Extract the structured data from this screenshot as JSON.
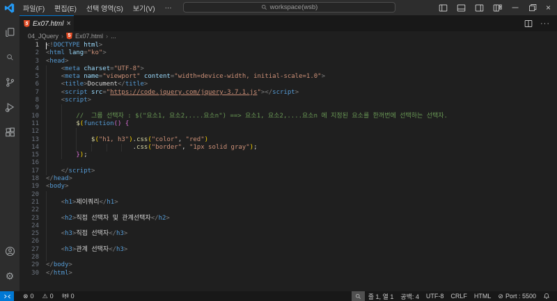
{
  "colors": {
    "accent": "#0078d4",
    "html_icon": "#e44d26",
    "remote_bg": "#0078d4"
  },
  "title_bar": {
    "menus": [
      {
        "name": "menu-file",
        "label": "파일(F)"
      },
      {
        "name": "menu-edit",
        "label": "편집(E)"
      },
      {
        "name": "menu-selection",
        "label": "선택 영역(S)"
      },
      {
        "name": "menu-view",
        "label": "보기(V)"
      },
      {
        "name": "menu-more",
        "label": "···"
      }
    ],
    "back_arrow": "←",
    "forward_arrow": "→",
    "command_center": "workspace(wsb)",
    "layout_icons": [
      "panel-left",
      "panel-bottom",
      "panel-right",
      "layout-customize"
    ],
    "window_controls": [
      "minimize",
      "restore",
      "close"
    ]
  },
  "activity_bar": {
    "top": [
      "explorer",
      "search",
      "source-control",
      "run-debug",
      "extensions"
    ],
    "bottom": [
      "accounts",
      "settings"
    ]
  },
  "editor": {
    "tab": {
      "label": "Ex07.html",
      "close": "×"
    },
    "actions": [
      "split-editor",
      "more-actions"
    ],
    "breadcrumb": {
      "folder": "04_JQuery",
      "file": "Ex07.html",
      "more": "...",
      "sep": "›"
    },
    "cursor": {
      "line": 1,
      "col": 1
    },
    "lines": [
      {
        "n": 1,
        "g": 0,
        "t": [
          [
            "pun",
            "<!"
          ],
          [
            "tag",
            "DOCTYPE"
          ],
          [
            "attr",
            " html"
          ],
          [
            "pun",
            ">"
          ]
        ]
      },
      {
        "n": 2,
        "g": 0,
        "t": [
          [
            "pun",
            "<"
          ],
          [
            "tag",
            "html"
          ],
          [
            "attr",
            " lang"
          ],
          [
            "pun",
            "="
          ],
          [
            "str",
            "\"ko\""
          ],
          [
            "pun",
            ">"
          ]
        ]
      },
      {
        "n": 3,
        "g": 0,
        "t": [
          [
            "pun",
            "<"
          ],
          [
            "tag",
            "head"
          ],
          [
            "pun",
            ">"
          ]
        ]
      },
      {
        "n": 4,
        "g": 1,
        "t": [
          [
            "txt",
            "    "
          ],
          [
            "pun",
            "<"
          ],
          [
            "tag",
            "meta"
          ],
          [
            "attr",
            " charset"
          ],
          [
            "pun",
            "="
          ],
          [
            "str",
            "\"UTF-8\""
          ],
          [
            "pun",
            ">"
          ]
        ]
      },
      {
        "n": 5,
        "g": 1,
        "t": [
          [
            "txt",
            "    "
          ],
          [
            "pun",
            "<"
          ],
          [
            "tag",
            "meta"
          ],
          [
            "attr",
            " name"
          ],
          [
            "pun",
            "="
          ],
          [
            "str",
            "\"viewport\""
          ],
          [
            "attr",
            " content"
          ],
          [
            "pun",
            "="
          ],
          [
            "str",
            "\"width=device-width, initial-scale=1.0\""
          ],
          [
            "pun",
            ">"
          ]
        ]
      },
      {
        "n": 6,
        "g": 1,
        "t": [
          [
            "txt",
            "    "
          ],
          [
            "pun",
            "<"
          ],
          [
            "tag",
            "title"
          ],
          [
            "pun",
            ">"
          ],
          [
            "txt",
            "Document"
          ],
          [
            "pun",
            "</"
          ],
          [
            "tag",
            "title"
          ],
          [
            "pun",
            ">"
          ]
        ]
      },
      {
        "n": 7,
        "g": 1,
        "t": [
          [
            "txt",
            "    "
          ],
          [
            "pun",
            "<"
          ],
          [
            "tag",
            "script"
          ],
          [
            "attr",
            " src"
          ],
          [
            "pun",
            "="
          ],
          [
            "str",
            "\""
          ],
          [
            "stru",
            "https://code.jquery.com/jquery-3.7.1.js"
          ],
          [
            "str",
            "\""
          ],
          [
            "pun",
            "></"
          ],
          [
            "tag",
            "script"
          ],
          [
            "pun",
            ">"
          ]
        ]
      },
      {
        "n": 8,
        "g": 1,
        "t": [
          [
            "txt",
            "    "
          ],
          [
            "pun",
            "<"
          ],
          [
            "tag",
            "script"
          ],
          [
            "pun",
            ">"
          ]
        ]
      },
      {
        "n": 9,
        "g": 2,
        "t": []
      },
      {
        "n": 10,
        "g": 2,
        "t": [
          [
            "com",
            "        //  그룹 선택자 : $(\"요소1, 요소2,....요소n\") ==> 요소1, 요소2,....요소n 에 지정된 요소를 한꺼번에 선택하는 선택자."
          ]
        ]
      },
      {
        "n": 11,
        "g": 2,
        "t": [
          [
            "txt",
            "        "
          ],
          [
            "fn",
            "$"
          ],
          [
            "p1",
            "("
          ],
          [
            "kw",
            "function"
          ],
          [
            "p2",
            "()"
          ],
          [
            "txt",
            " "
          ],
          [
            "p2",
            "{"
          ]
        ]
      },
      {
        "n": 12,
        "g": 3,
        "t": []
      },
      {
        "n": 13,
        "g": 3,
        "t": [
          [
            "txt",
            "            "
          ],
          [
            "fn",
            "$"
          ],
          [
            "p1",
            "("
          ],
          [
            "str",
            "\"h1, h3\""
          ],
          [
            "p1",
            ")"
          ],
          [
            "txt",
            "."
          ],
          [
            "fn",
            "css"
          ],
          [
            "p1",
            "("
          ],
          [
            "str",
            "\"color\""
          ],
          [
            "txt",
            ", "
          ],
          [
            "str",
            "\"red\""
          ],
          [
            "p1",
            ")"
          ]
        ]
      },
      {
        "n": 14,
        "g": 6,
        "t": [
          [
            "txt",
            "                       "
          ],
          [
            "txt",
            "."
          ],
          [
            "fn",
            "css"
          ],
          [
            "p1",
            "("
          ],
          [
            "str",
            "\"border\""
          ],
          [
            "txt",
            ", "
          ],
          [
            "str",
            "\"1px solid gray\""
          ],
          [
            "p1",
            ")"
          ],
          [
            "txt",
            ";"
          ]
        ]
      },
      {
        "n": 15,
        "g": 2,
        "t": [
          [
            "txt",
            "        "
          ],
          [
            "p2",
            "}"
          ],
          [
            "p1",
            ")"
          ],
          [
            "txt",
            ";"
          ]
        ]
      },
      {
        "n": 16,
        "g": 1,
        "t": []
      },
      {
        "n": 17,
        "g": 1,
        "t": [
          [
            "txt",
            "    "
          ],
          [
            "pun",
            "</"
          ],
          [
            "tag",
            "script"
          ],
          [
            "pun",
            ">"
          ]
        ]
      },
      {
        "n": 18,
        "g": 0,
        "t": [
          [
            "pun",
            "</"
          ],
          [
            "tag",
            "head"
          ],
          [
            "pun",
            ">"
          ]
        ]
      },
      {
        "n": 19,
        "g": 0,
        "t": [
          [
            "pun",
            "<"
          ],
          [
            "tag",
            "body"
          ],
          [
            "pun",
            ">"
          ]
        ]
      },
      {
        "n": 20,
        "g": 1,
        "t": []
      },
      {
        "n": 21,
        "g": 1,
        "t": [
          [
            "txt",
            "    "
          ],
          [
            "pun",
            "<"
          ],
          [
            "tag",
            "h1"
          ],
          [
            "pun",
            ">"
          ],
          [
            "txt",
            "제이쿼리"
          ],
          [
            "pun",
            "</"
          ],
          [
            "tag",
            "h1"
          ],
          [
            "pun",
            ">"
          ]
        ]
      },
      {
        "n": 22,
        "g": 1,
        "t": []
      },
      {
        "n": 23,
        "g": 1,
        "t": [
          [
            "txt",
            "    "
          ],
          [
            "pun",
            "<"
          ],
          [
            "tag",
            "h2"
          ],
          [
            "pun",
            ">"
          ],
          [
            "txt",
            "직접 선택자 및 관계선택자"
          ],
          [
            "pun",
            "</"
          ],
          [
            "tag",
            "h2"
          ],
          [
            "pun",
            ">"
          ]
        ]
      },
      {
        "n": 24,
        "g": 1,
        "t": []
      },
      {
        "n": 25,
        "g": 1,
        "t": [
          [
            "txt",
            "    "
          ],
          [
            "pun",
            "<"
          ],
          [
            "tag",
            "h3"
          ],
          [
            "pun",
            ">"
          ],
          [
            "txt",
            "직접 선택자"
          ],
          [
            "pun",
            "</"
          ],
          [
            "tag",
            "h3"
          ],
          [
            "pun",
            ">"
          ]
        ]
      },
      {
        "n": 26,
        "g": 1,
        "t": []
      },
      {
        "n": 27,
        "g": 1,
        "t": [
          [
            "txt",
            "    "
          ],
          [
            "pun",
            "<"
          ],
          [
            "tag",
            "h3"
          ],
          [
            "pun",
            ">"
          ],
          [
            "txt",
            "관계 선택자"
          ],
          [
            "pun",
            "</"
          ],
          [
            "tag",
            "h3"
          ],
          [
            "pun",
            ">"
          ]
        ]
      },
      {
        "n": 28,
        "g": 1,
        "t": []
      },
      {
        "n": 29,
        "g": 0,
        "t": [
          [
            "pun",
            "</"
          ],
          [
            "tag",
            "body"
          ],
          [
            "pun",
            ">"
          ]
        ]
      },
      {
        "n": 30,
        "g": 0,
        "t": [
          [
            "pun",
            "</"
          ],
          [
            "tag",
            "html"
          ],
          [
            "pun",
            ">"
          ]
        ]
      }
    ]
  },
  "status_bar": {
    "left": [
      {
        "name": "errors-indicator",
        "icon": "error",
        "label": "0"
      },
      {
        "name": "warnings-indicator",
        "icon": "warning",
        "label": "0"
      },
      {
        "name": "broadcast-indicator",
        "icon": "broadcast",
        "label": "0"
      }
    ],
    "right": [
      {
        "name": "zoom-indicator",
        "icon": "zoom",
        "label": "",
        "box": true
      },
      {
        "name": "cursor-position",
        "label": "줄 1, 열 1"
      },
      {
        "name": "indentation",
        "label": "공백: 4"
      },
      {
        "name": "encoding",
        "label": "UTF-8"
      },
      {
        "name": "eol-sequence",
        "label": "CRLF"
      },
      {
        "name": "language-mode",
        "label": "HTML"
      },
      {
        "name": "live-server-port",
        "icon": "circle-slash",
        "label": "Port : 5500"
      },
      {
        "name": "notifications",
        "icon": "bell",
        "label": ""
      }
    ]
  }
}
